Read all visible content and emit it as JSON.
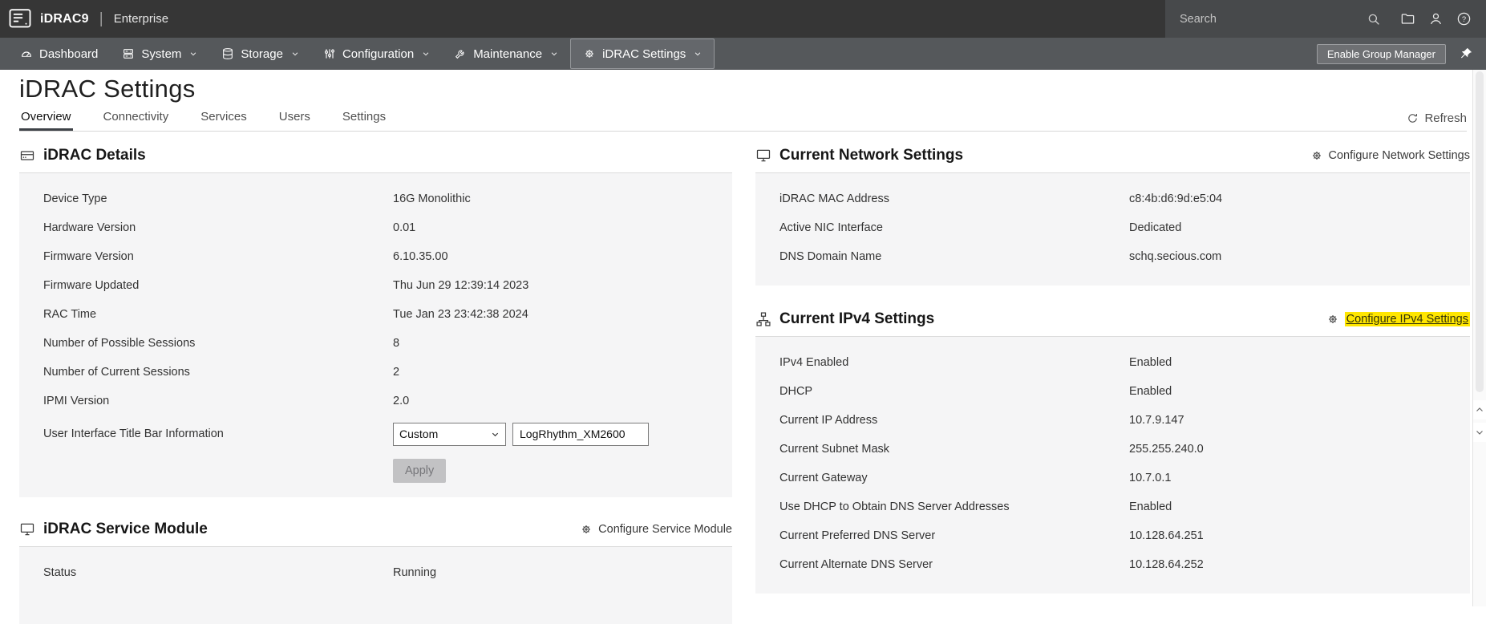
{
  "topbar": {
    "brand": "iDRAC9",
    "divider": "|",
    "edition": "Enterprise",
    "search_placeholder": "Search"
  },
  "nav": {
    "items": [
      {
        "label": "Dashboard"
      },
      {
        "label": "System"
      },
      {
        "label": "Storage"
      },
      {
        "label": "Configuration"
      },
      {
        "label": "Maintenance"
      },
      {
        "label": "iDRAC Settings"
      }
    ],
    "group_manager_label": "Enable Group Manager"
  },
  "page": {
    "title": "iDRAC Settings",
    "tabs": [
      "Overview",
      "Connectivity",
      "Services",
      "Users",
      "Settings"
    ],
    "active_tab": "Overview",
    "refresh_label": "Refresh"
  },
  "idrac_details": {
    "title": "iDRAC Details",
    "rows": [
      {
        "label": "Device Type",
        "value": "16G Monolithic"
      },
      {
        "label": "Hardware Version",
        "value": "0.01"
      },
      {
        "label": "Firmware Version",
        "value": "6.10.35.00"
      },
      {
        "label": "Firmware Updated",
        "value": "Thu Jun 29 12:39:14 2023"
      },
      {
        "label": "RAC Time",
        "value": "Tue Jan 23 23:42:38 2024"
      },
      {
        "label": "Number of Possible Sessions",
        "value": "8"
      },
      {
        "label": "Number of Current Sessions",
        "value": "2"
      },
      {
        "label": "IPMI Version",
        "value": "2.0"
      }
    ],
    "title_bar": {
      "label": "User Interface Title Bar Information",
      "select_value": "Custom",
      "input_value": "LogRhythm_XM2600"
    },
    "apply_label": "Apply"
  },
  "service_module": {
    "title": "iDRAC Service Module",
    "configure_label": "Configure Service Module",
    "rows": [
      {
        "label": "Status",
        "value": "Running"
      }
    ]
  },
  "network_settings": {
    "title": "Current Network Settings",
    "configure_label": "Configure Network Settings",
    "rows": [
      {
        "label": "iDRAC MAC Address",
        "value": "c8:4b:d6:9d:e5:04"
      },
      {
        "label": "Active NIC Interface",
        "value": "Dedicated"
      },
      {
        "label": "DNS Domain Name",
        "value": "schq.secious.com"
      }
    ]
  },
  "ipv4_settings": {
    "title": "Current IPv4 Settings",
    "configure_label": "Configure IPv4 Settings",
    "configure_highlighted": true,
    "rows": [
      {
        "label": "IPv4 Enabled",
        "value": "Enabled"
      },
      {
        "label": "DHCP",
        "value": "Enabled"
      },
      {
        "label": "Current IP Address",
        "value": "10.7.9.147"
      },
      {
        "label": "Current Subnet Mask",
        "value": "255.255.240.0"
      },
      {
        "label": "Current Gateway",
        "value": "10.7.0.1"
      },
      {
        "label": "Use DHCP to Obtain DNS Server Addresses",
        "value": "Enabled"
      },
      {
        "label": "Current Preferred DNS Server",
        "value": "10.128.64.251"
      },
      {
        "label": "Current Alternate DNS Server",
        "value": "10.128.64.252"
      }
    ]
  },
  "icons": {
    "help_glyph": "?",
    "map": {
      "search-icon": "magnifier shape",
      "folder-icon": "folder shape",
      "user-icon": "person silhouette",
      "help-icon": "question-mark circle",
      "dashboard-icon": "gauge",
      "system-icon": "server stack",
      "storage-icon": "disk cylinder",
      "configuration-icon": "sliders",
      "maintenance-icon": "wrench",
      "gear-icon": "gear",
      "pin-icon": "pushpin",
      "monitor-icon": "display",
      "server-icon": "server box",
      "network-icon": "network topology nodes",
      "refresh-icon": "circular arrow",
      "chevron-down-icon": "caret down",
      "chevron-up-icon": "caret up"
    }
  },
  "colors": {
    "topbar_bg": "#363636",
    "topbar_right_bg": "#47494b",
    "navbar_bg": "#55585b",
    "nav_active_bg": "#64676b",
    "card_body_bg": "#f5f5f6",
    "tab_underline": "#3e4247",
    "highlight": "#ffe600",
    "apply_bg": "#c2c2c4"
  }
}
